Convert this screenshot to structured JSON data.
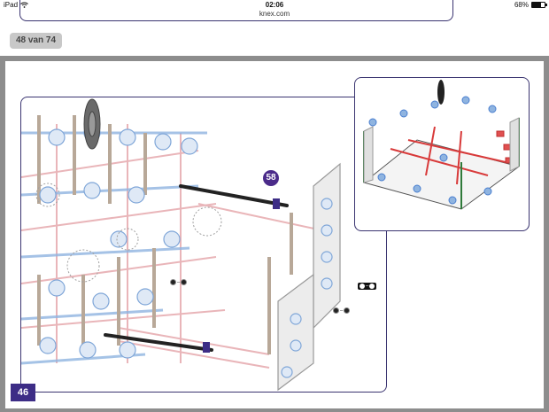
{
  "status_bar": {
    "device": "iPad",
    "time": "02:06",
    "battery": "68%",
    "battery_level": 0.68,
    "wifi_icon": "wifi-icon"
  },
  "browser": {
    "url": "knex.com"
  },
  "viewer": {
    "page_indicator": "48 van 74"
  },
  "instruction_page": {
    "step_number": "58",
    "page_number": "46",
    "part_counts": [
      {
        "label": "–"
      },
      {
        "label": "–"
      },
      {
        "label": "–"
      }
    ],
    "colors": {
      "accent": "#3d2d86",
      "frame": "#3a3470",
      "rod_red": "#d87a80",
      "rod_blue": "#8fb4e0",
      "connector_white": "#e8e8e8",
      "connector_grey": "#9a9a9a",
      "rod_black": "#222222"
    }
  }
}
